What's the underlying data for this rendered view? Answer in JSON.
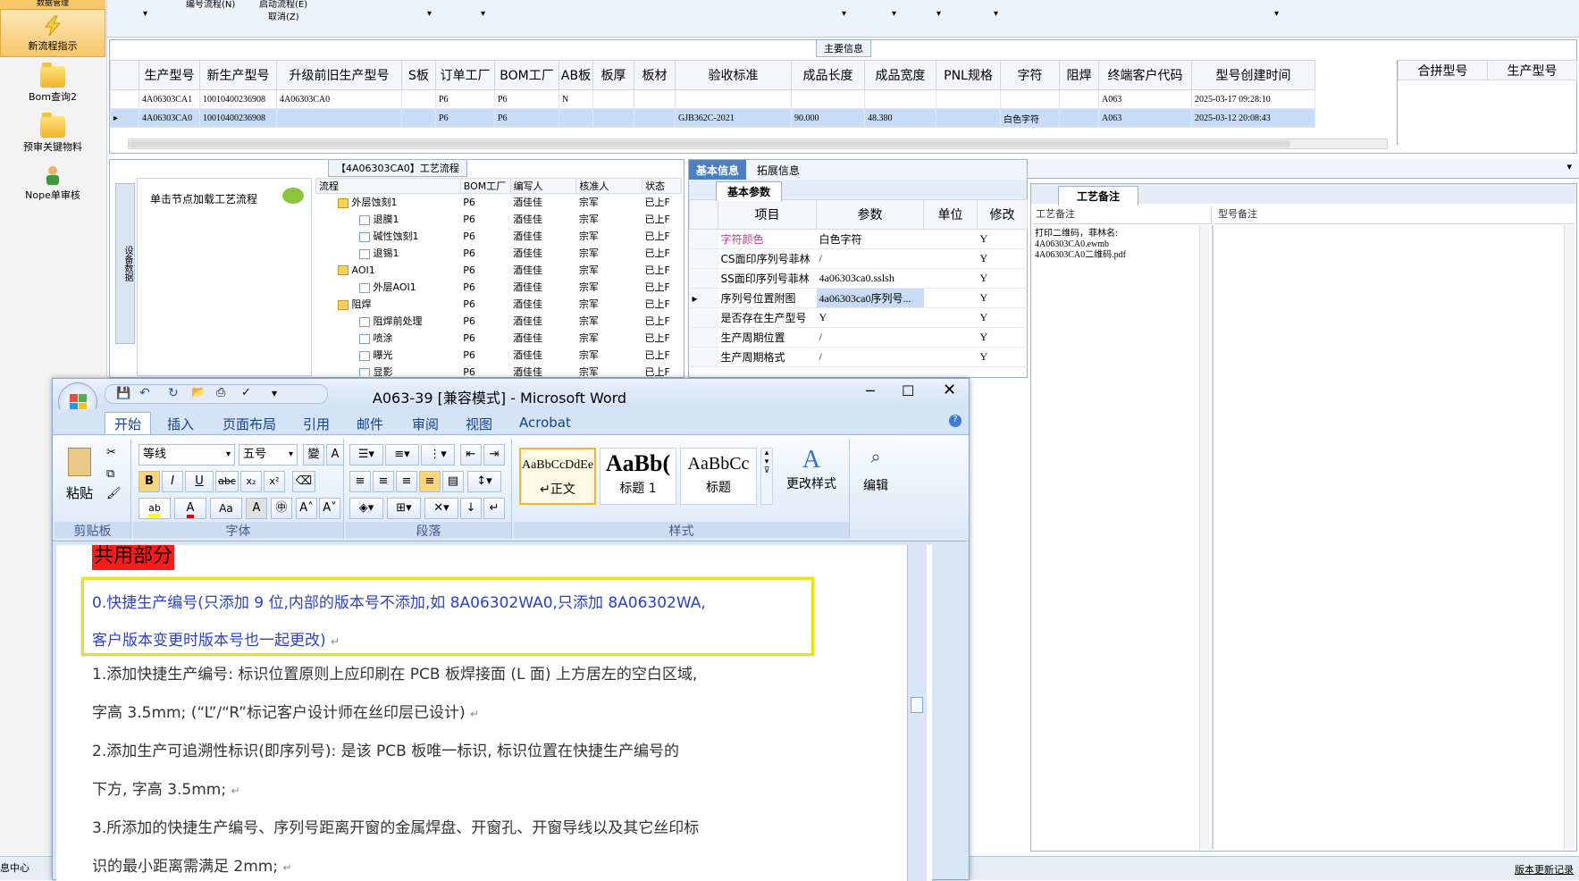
{
  "leftnav": {
    "top_label": "数据管理",
    "items": [
      {
        "label": "新流程指示",
        "icon": "lightning-icon"
      },
      {
        "label": "Bom查询2",
        "icon": "folder-icon"
      },
      {
        "label": "预审关键物料",
        "icon": "folder-icon"
      },
      {
        "label": "Nope单审核",
        "icon": "user-icon"
      }
    ],
    "bottom_label": "息中心"
  },
  "topstrip": {
    "label1": "编号流程(N)",
    "label2": "启动流程(E)",
    "label3": "取消(Z)"
  },
  "main_info": {
    "title": "主要信息",
    "columns": [
      "生产型号",
      "新生产型号",
      "升级前旧生产型号",
      "S板",
      "订单工厂",
      "BOM工厂",
      "AB板",
      "板厚",
      "板材",
      "验收标准",
      "成品长度",
      "成品宽度",
      "PNL规格",
      "字符",
      "阻焊",
      "终端客户代码",
      "型号创建时间"
    ],
    "rows": [
      [
        "4A06303CA1",
        "10010400236908",
        "4A06303CA0",
        "",
        "P6",
        "P6",
        "N",
        "",
        "",
        "",
        "",
        "",
        "",
        "",
        "",
        "A063",
        "2025-03-17 09:28:10"
      ],
      [
        "4A06303CA0",
        "10010400236908",
        "",
        "",
        "P6",
        "P6",
        "",
        "",
        "",
        "GJB362C-2021",
        "90.000",
        "48.380",
        "",
        "白色字符",
        "",
        "A063",
        "2025-03-12 20:08:43"
      ]
    ],
    "side_columns": [
      "合拼型号",
      "生产型号"
    ]
  },
  "process": {
    "title": "【4A06303CA0】工艺流程",
    "side_label": "设备数据",
    "node_hint": "单击节点加载工艺流程",
    "columns": [
      "流程",
      "BOM工厂",
      "编写人",
      "核准人",
      "状态"
    ],
    "rows": [
      {
        "name": "外层蚀刻1",
        "level": 1,
        "bom": "P6",
        "writer": "酒佳佳",
        "approver": "宗军",
        "status": "已上F"
      },
      {
        "name": "退膜1",
        "level": 2,
        "bom": "P6",
        "writer": "酒佳佳",
        "approver": "宗军",
        "status": "已上F"
      },
      {
        "name": "碱性蚀刻1",
        "level": 2,
        "bom": "P6",
        "writer": "酒佳佳",
        "approver": "宗军",
        "status": "已上F"
      },
      {
        "name": "退锡1",
        "level": 2,
        "bom": "P6",
        "writer": "酒佳佳",
        "approver": "宗军",
        "status": "已上F"
      },
      {
        "name": "AOI1",
        "level": 1,
        "bom": "P6",
        "writer": "酒佳佳",
        "approver": "宗军",
        "status": "已上F"
      },
      {
        "name": "外层AOI1",
        "level": 2,
        "bom": "P6",
        "writer": "酒佳佳",
        "approver": "宗军",
        "status": "已上F"
      },
      {
        "name": "阻焊",
        "level": 1,
        "bom": "P6",
        "writer": "酒佳佳",
        "approver": "宗军",
        "status": "已上F"
      },
      {
        "name": "阻焊前处理",
        "level": 2,
        "bom": "P6",
        "writer": "酒佳佳",
        "approver": "宗军",
        "status": "已上F"
      },
      {
        "name": "喷涂",
        "level": 2,
        "bom": "P6",
        "writer": "酒佳佳",
        "approver": "宗军",
        "status": "已上F"
      },
      {
        "name": "曝光",
        "level": 2,
        "bom": "P6",
        "writer": "酒佳佳",
        "approver": "宗军",
        "status": "已上F"
      },
      {
        "name": "显影",
        "level": 2,
        "bom": "P6",
        "writer": "酒佳佳",
        "approver": "宗军",
        "status": "已上F"
      }
    ]
  },
  "basic": {
    "tabs": [
      "基本信息",
      "拓展信息"
    ],
    "subtab": "基本参数",
    "columns": [
      "项目",
      "参数",
      "单位",
      "修改"
    ],
    "rows": [
      {
        "item": "字符颜色",
        "param": "白色字符",
        "unit": "",
        "edit": "Y"
      },
      {
        "item": "CS面印序列号菲林",
        "param": "/",
        "unit": "",
        "edit": "Y"
      },
      {
        "item": "SS面印序列号菲林",
        "param": "4a06303ca0.sslsh",
        "unit": "",
        "edit": "Y"
      },
      {
        "item": "序列号位置附图",
        "param": "4a06303ca0序列号...",
        "unit": "",
        "edit": "Y"
      },
      {
        "item": "是否存在生产型号",
        "param": "Y",
        "unit": "",
        "edit": "Y"
      },
      {
        "item": "生产周期位置",
        "param": "/",
        "unit": "",
        "edit": "Y"
      },
      {
        "item": "生产周期格式",
        "param": "/",
        "unit": "",
        "edit": "Y"
      }
    ]
  },
  "craft": {
    "tab": "工艺备注",
    "col1": "工艺备注",
    "col2": "型号备注",
    "note_lines": [
      "打印二维码，菲林名:",
      "4A06303CA0.ewmb",
      "4A06303CA0二维码.pdf"
    ]
  },
  "statusbar": {
    "right": "版本更新记录"
  },
  "word": {
    "title": "A063-39 [兼容模式] - Microsoft Word",
    "tabs": [
      "开始",
      "插入",
      "页面布局",
      "引用",
      "邮件",
      "审阅",
      "视图",
      "Acrobat"
    ],
    "font_name": "等线",
    "font_size": "五号",
    "group_labels": [
      "剪贴板",
      "字体",
      "段落",
      "样式"
    ],
    "paste_label": "粘贴",
    "styles": [
      {
        "preview": "AaBbCcDdEe",
        "name": "↵正文"
      },
      {
        "preview": "AaBb(",
        "name": "标题 1"
      },
      {
        "preview": "AaBbCc",
        "name": "标题"
      }
    ],
    "change_style": "更改样式",
    "edit_label": "编辑",
    "doc": {
      "heading": "共用部分",
      "p0_line1": "0.快捷生产编号(只添加 9 位,内部的版本号不添加,如 8A06302WA0,只添加 8A06302WA,",
      "p0_line2": "客户版本变更时版本号也一起更改)",
      "p1_line1": "1.添加快捷生产编号: 标识位置原则上应印刷在 PCB 板焊接面 (L 面) 上方居左的空白区域,",
      "p1_line2": "字高 3.5mm; (“L”/“R”标记客户设计师在丝印层已设计)",
      "p2_line1": "2.添加生产可追溯性标识(即序列号): 是该 PCB 板唯一标识, 标识位置在快捷生产编号的",
      "p2_line2": "下方, 字高 3.5mm;",
      "p3_line1": "3.所添加的快捷生产编号、序列号距离开窗的金属焊盘、开窗孔、开窗导线以及其它丝印标",
      "p3_line2": "识的最小距离需满足 2mm;"
    }
  },
  "colors": {
    "accent": "#4d7fc2",
    "highlight_red": "#ff1a1a",
    "yellow_box": "#e8e21c",
    "selection": "#c9dcf5"
  }
}
